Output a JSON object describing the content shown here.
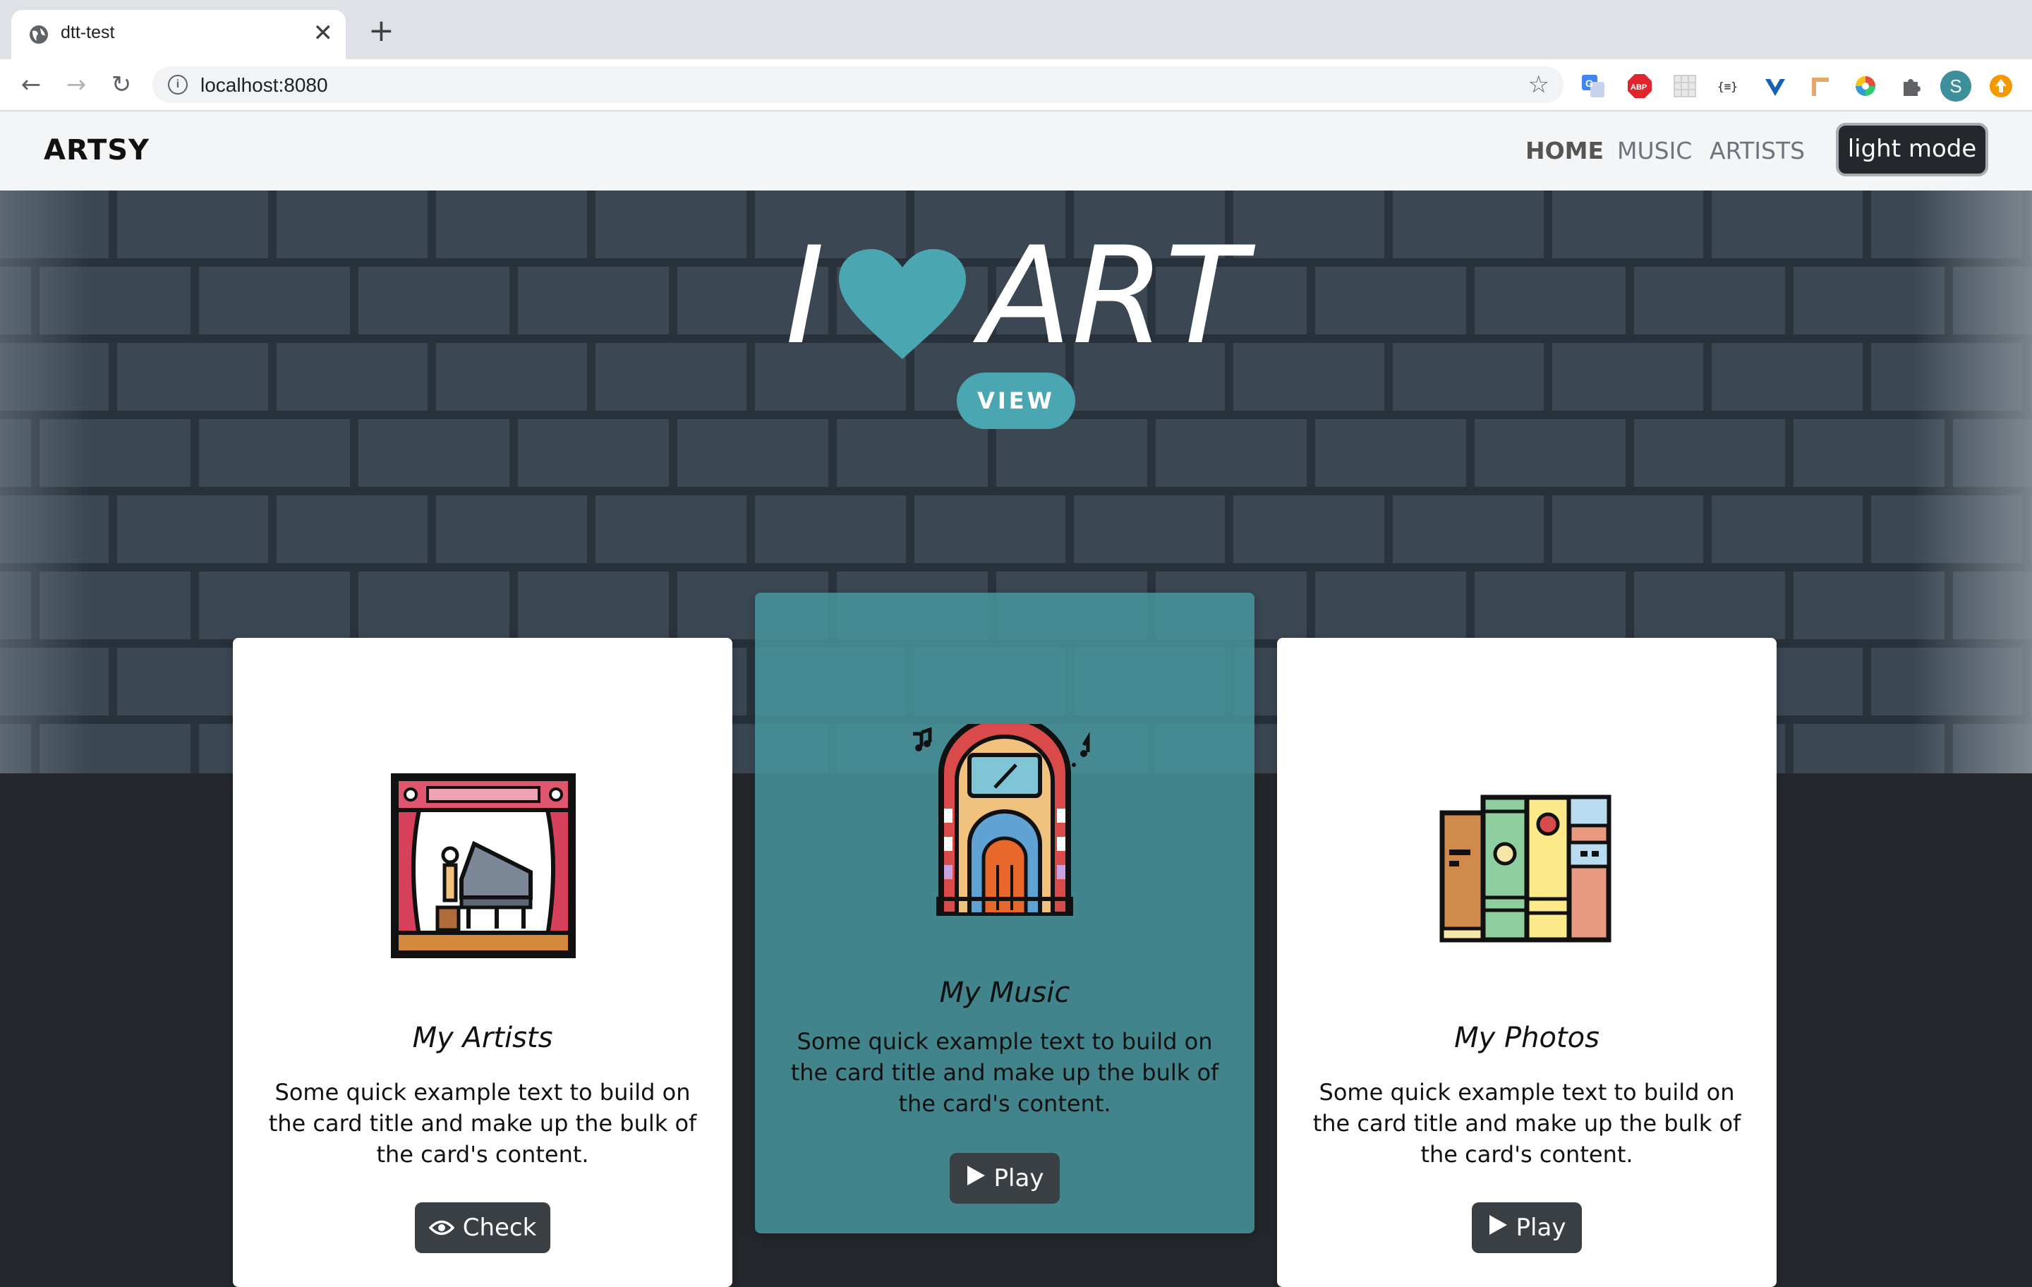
{
  "browser": {
    "tab_title": "dtt-test",
    "tab_close": "✕",
    "new_tab": "+",
    "back": "←",
    "forward": "→",
    "reload": "↻",
    "url": "localhost:8080",
    "bookmark_star": "☆",
    "profile_initial": "S",
    "ext_abp": "ABP"
  },
  "site": {
    "brand": "ARTSY",
    "nav": [
      {
        "label": "HOME",
        "active": true
      },
      {
        "label": "MUSIC",
        "active": false
      },
      {
        "label": "ARTISTS",
        "active": false
      }
    ],
    "mode_button": "light mode"
  },
  "hero": {
    "title_left": "I",
    "title_right": "ART",
    "heart_icon": "heart-icon",
    "view_button": "VIEW"
  },
  "cards": [
    {
      "title": "My Artists",
      "text": "Some quick example text to build on the card title and make up the bulk of the card's content.",
      "button": "Check",
      "button_icon": "eye-icon",
      "icon": "theater-piano-icon"
    },
    {
      "title": "My Music",
      "text": "Some quick example text to build on the card title and make up the bulk of the card's content.",
      "button": "Play",
      "button_icon": "play-icon",
      "icon": "jukebox-icon"
    },
    {
      "title": "My Photos",
      "text": "Some quick example text to build on the card title and make up the bulk of the card's content.",
      "button": "Play",
      "button_icon": "play-icon",
      "icon": "books-icon"
    }
  ],
  "colors": {
    "accent": "#4aa6b0",
    "dark": "#24282c",
    "featured_card": "#4898a0"
  }
}
